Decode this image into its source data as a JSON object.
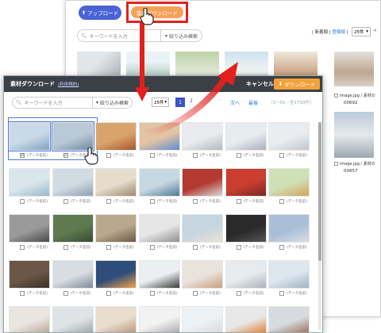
{
  "background": {
    "upload_label": "アップロード",
    "download_label": "素材ダウンロード",
    "search_placeholder": "キーワードを入力",
    "filter_label": "絞り込み検索",
    "sort_new": "新着順",
    "sort_label": "登録順",
    "sort_divider": "|",
    "count_value": "25件",
    "prev_arrow": "<",
    "card1_label": "image.jpg / 素材の",
    "card1_id": "00692",
    "card2_label": "image.jpg / 素材の",
    "card2_id": "00857"
  },
  "modal": {
    "title": "素材ダウンロード",
    "terms_link": "(利用規約)",
    "cancel_label": "キャンセル",
    "download_label": "ダウンロード",
    "search_placeholder": "キーワードを入力",
    "filter_label": "絞り込み検索",
    "count_value": "25件",
    "page_current": "1",
    "page_next": "2",
    "next_label": "次へ",
    "last_label": "最後",
    "range_text": "［1～50／全1793件］",
    "cells": [
      {
        "caption": "(データ名前)",
        "checked": "☑",
        "color": "#c9d9e6",
        "accent": "#7fa3bd"
      },
      {
        "caption": "(データ名前)",
        "checked": "☑",
        "color": "#b9c9d6",
        "accent": "#6f8aa0"
      },
      {
        "caption": "(データ名前)",
        "checked": "",
        "color": "#d9a46b",
        "accent": "#a8572b"
      },
      {
        "caption": "(データ名前)",
        "checked": "",
        "color": "#e2c3a3",
        "accent": "#5e8ed0"
      },
      {
        "caption": "(データ名前)",
        "checked": "",
        "color": "#e9ebee",
        "accent": "#b4b8bf"
      },
      {
        "caption": "(データ名前)",
        "checked": "",
        "color": "#e7ecef",
        "accent": "#aab1b9"
      },
      {
        "caption": "(データ名前)",
        "checked": "",
        "color": "#e9edf0",
        "accent": "#c0c6cc"
      },
      {
        "caption": "(データ名前)",
        "checked": "",
        "color": "#d9e7ec",
        "accent": "#97b8c8"
      },
      {
        "caption": "(データ名前)",
        "checked": "",
        "color": "#d2dbe2",
        "accent": "#8aa0b2"
      },
      {
        "caption": "(データ名前)",
        "checked": "",
        "color": "#e5dccd",
        "accent": "#9c8a6d"
      },
      {
        "caption": "(データ名前)",
        "checked": "",
        "color": "#c7d8e2",
        "accent": "#4f7a95"
      },
      {
        "caption": "(データ名前)",
        "checked": "",
        "color": "#b23a31",
        "accent": "#d9d9d9"
      },
      {
        "caption": "(データ名前)",
        "checked": "",
        "color": "#c93e2f",
        "accent": "#7a2a24"
      },
      {
        "caption": "(データ名前)",
        "checked": "",
        "color": "#cfe0b6",
        "accent": "#d1a45a"
      },
      {
        "caption": "(データ名前)",
        "checked": "",
        "color": "#9a9a9a",
        "accent": "#4a4a4a"
      },
      {
        "caption": "(データ名前)",
        "checked": "",
        "color": "#5f7a4e",
        "accent": "#3a4c33"
      },
      {
        "caption": "(データ名前)",
        "checked": "",
        "color": "#b9a88e",
        "accent": "#6b5a45"
      },
      {
        "caption": "(データ名前)",
        "checked": "",
        "color": "#e6e6e6",
        "accent": "#8f8f8f"
      },
      {
        "caption": "(データ名前)",
        "checked": "",
        "color": "#c5d6e1",
        "accent": "#e9e2d3"
      },
      {
        "caption": "(データ名前)",
        "checked": "",
        "color": "#2a2a2a",
        "accent": "#555555"
      },
      {
        "caption": "(データ名前)",
        "checked": "",
        "color": "#a9bfd8",
        "accent": "#d9dde3"
      },
      {
        "caption": "(データ名前)",
        "checked": "",
        "color": "#6b5647",
        "accent": "#3a2e27"
      },
      {
        "caption": "(データ名前)",
        "checked": "",
        "color": "#d8dde2",
        "accent": "#7f8b96"
      },
      {
        "caption": "(データ名前)",
        "checked": "",
        "color": "#2f4d7a",
        "accent": "#f3a248"
      },
      {
        "caption": "(データ名前)",
        "checked": "",
        "color": "#eceff1",
        "accent": "#3a3a3a"
      },
      {
        "caption": "(データ名前)",
        "checked": "",
        "color": "#eae3dc",
        "accent": "#c99d7e"
      },
      {
        "caption": "(データ名前)",
        "checked": "",
        "color": "#e8ebee",
        "accent": "#a9b3bd"
      },
      {
        "caption": "(データ名前)",
        "checked": "",
        "color": "#dde6ed",
        "accent": "#9fb3c4"
      },
      {
        "caption": "",
        "checked": "",
        "color": "#e9e6e2",
        "accent": "#b8a793"
      },
      {
        "caption": "",
        "checked": "",
        "color": "#dfe3e6",
        "accent": "#9aa4ae"
      },
      {
        "caption": "",
        "checked": "",
        "color": "#e9ddd0",
        "accent": "#b89273"
      },
      {
        "caption": "",
        "checked": "",
        "color": "#f2f2f2",
        "accent": "#a7a7a7"
      },
      {
        "caption": "",
        "checked": "",
        "color": "#eef1f3",
        "accent": "#d6dadf"
      },
      {
        "caption": "",
        "checked": "",
        "color": "#e7e7e7",
        "accent": "#e07a2c"
      },
      {
        "caption": "",
        "checked": "",
        "color": "#d7dbe0",
        "accent": "#9b6c56"
      }
    ]
  }
}
